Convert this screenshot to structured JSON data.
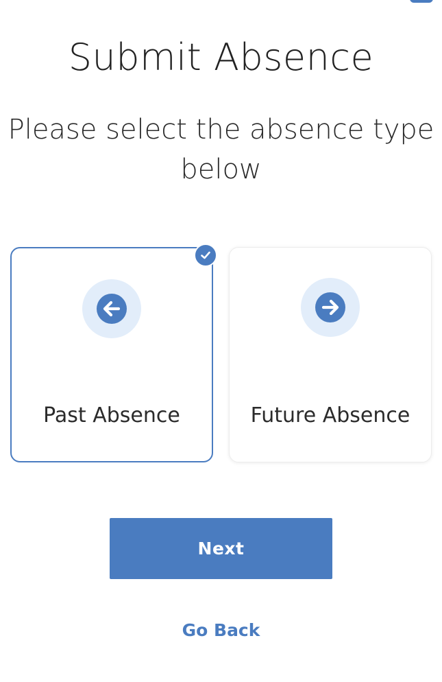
{
  "header": {
    "title": "Submit Absence",
    "subtitle": "Please select the absence type below"
  },
  "options": [
    {
      "label": "Past Absence",
      "icon": "arrow-left-circle-icon",
      "selected": true
    },
    {
      "label": "Future Absence",
      "icon": "arrow-right-circle-icon",
      "selected": false
    }
  ],
  "actions": {
    "next_label": "Next",
    "go_back_label": "Go Back"
  },
  "colors": {
    "accent": "#4a7cc0",
    "icon_background": "#e2edfa",
    "text": "#2b2b2b"
  }
}
